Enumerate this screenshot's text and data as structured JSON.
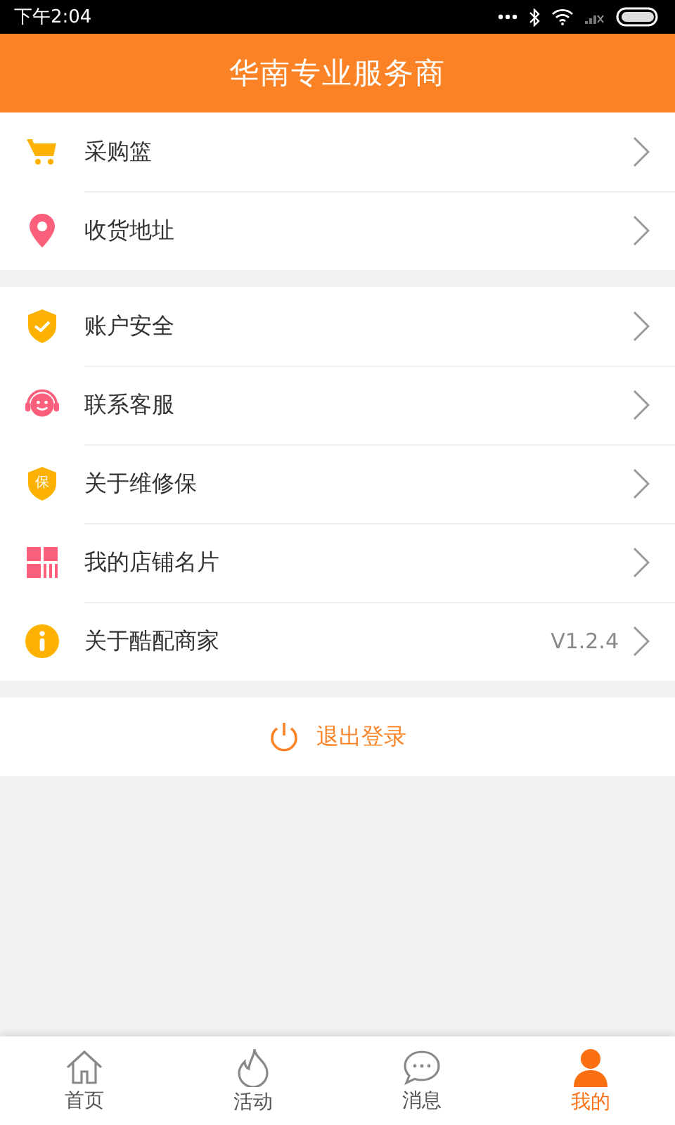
{
  "status_bar": {
    "time": "下午2:04"
  },
  "header": {
    "title": "华南专业服务商"
  },
  "groups": [
    {
      "items": [
        {
          "kind": "cart",
          "label": "采购篮"
        },
        {
          "kind": "pin",
          "label": "收货地址"
        }
      ]
    },
    {
      "items": [
        {
          "kind": "shield",
          "label": "账户安全"
        },
        {
          "kind": "service",
          "label": "联系客服"
        },
        {
          "kind": "badge",
          "icon_text": "保",
          "label": "关于维修保"
        },
        {
          "kind": "card",
          "label": "我的店铺名片"
        },
        {
          "kind": "info",
          "label": "关于酷配商家",
          "value": "V1.2.4"
        }
      ]
    }
  ],
  "logout": {
    "label": "退出登录"
  },
  "tabs": [
    {
      "kind": "home",
      "label": "首页",
      "selected": false
    },
    {
      "kind": "flame",
      "label": "活动",
      "selected": false
    },
    {
      "kind": "chat",
      "label": "消息",
      "selected": false
    },
    {
      "kind": "person",
      "label": "我的",
      "selected": true
    }
  ]
}
